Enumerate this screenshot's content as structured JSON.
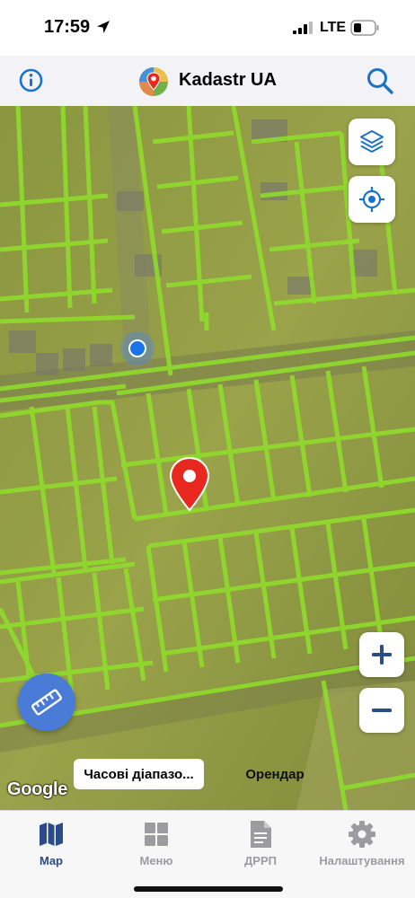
{
  "status_bar": {
    "time": "17:59",
    "network": "LTE"
  },
  "header": {
    "title": "Kadastr UA",
    "accent_color": "#1a73c9"
  },
  "map": {
    "layer_color": "#8fdc2c",
    "pin_color": "#e8281e",
    "user_location_color": "#1a73e8",
    "attribution": "Google",
    "chips": {
      "time_range": "Часові діапазо...",
      "rent": "Орендар"
    },
    "icons": [
      "layers-icon",
      "crosshair-icon",
      "plus-icon",
      "minus-icon",
      "ruler-icon"
    ]
  },
  "tabbar": {
    "items": [
      {
        "label": "Map",
        "icon": "map-icon",
        "active": true
      },
      {
        "label": "Меню",
        "icon": "grid-icon",
        "active": false
      },
      {
        "label": "ДРРП",
        "icon": "document-icon",
        "active": false
      },
      {
        "label": "Налаштування",
        "icon": "gear-icon",
        "active": false
      }
    ],
    "active_color": "#2b4b8a",
    "inactive_color": "#9b9ba0"
  }
}
